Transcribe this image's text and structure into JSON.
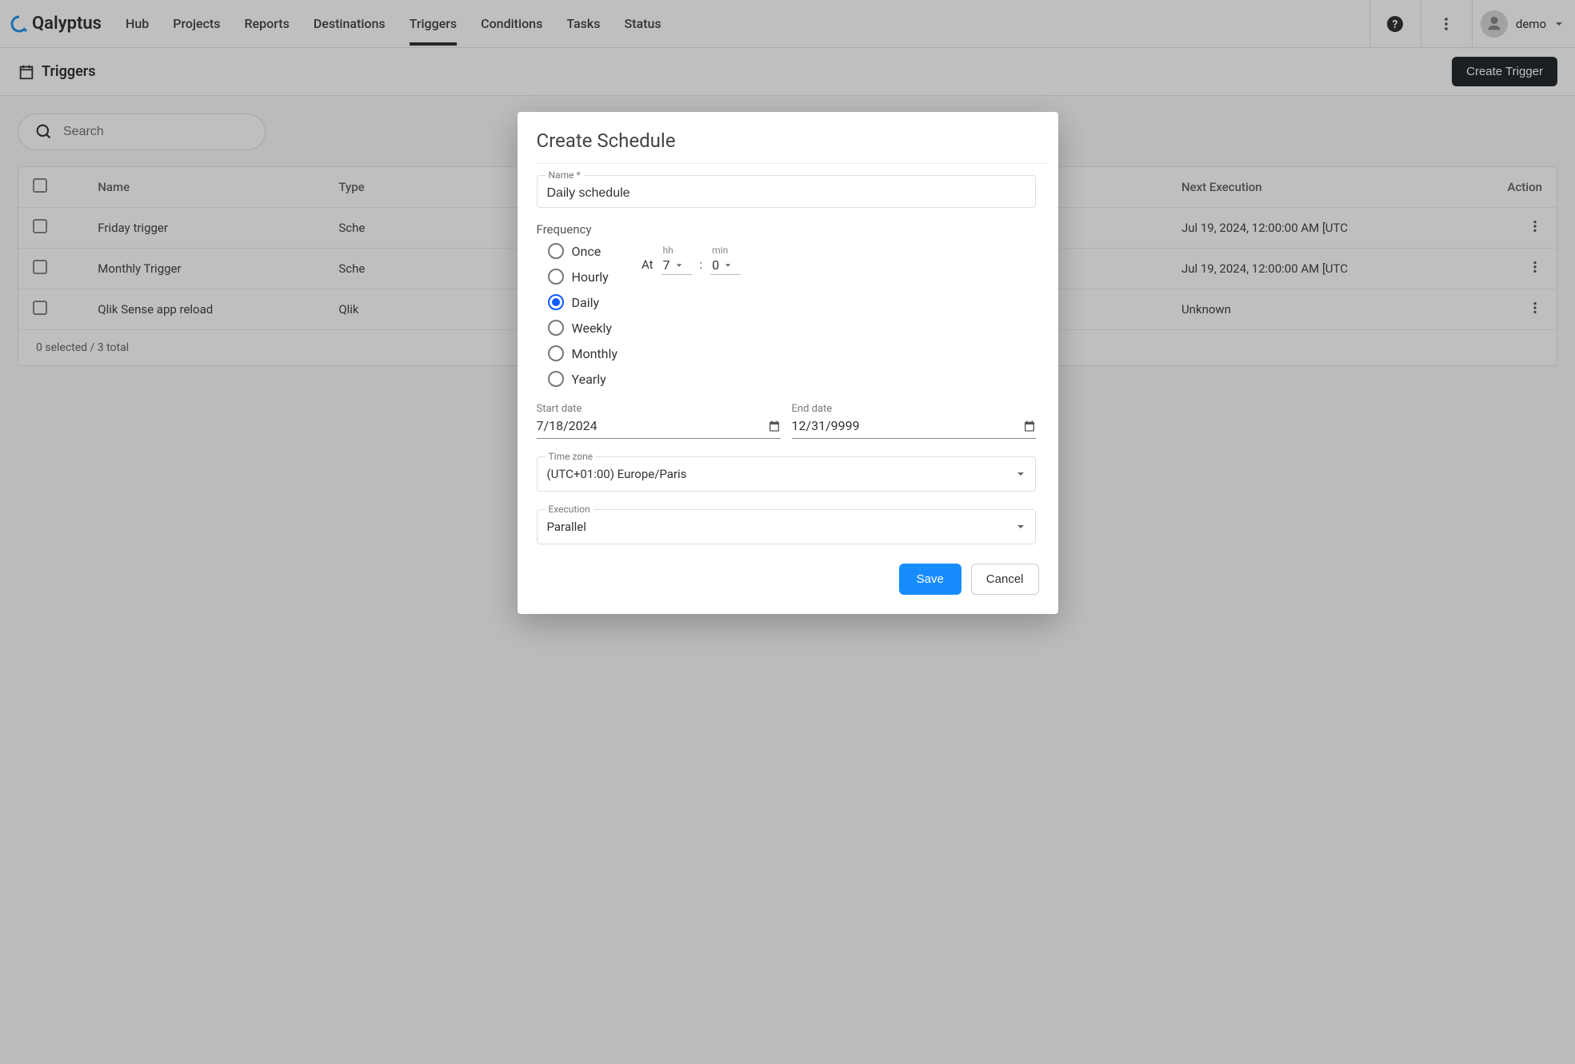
{
  "brand": "Qalyptus",
  "nav": {
    "items": [
      "Hub",
      "Projects",
      "Reports",
      "Destinations",
      "Triggers",
      "Conditions",
      "Tasks",
      "Status"
    ],
    "active_index": 4
  },
  "user": {
    "name": "demo"
  },
  "page": {
    "title": "Triggers",
    "create_button": "Create Trigger",
    "search_placeholder": "Search",
    "columns": [
      "Name",
      "Type",
      "Next Execution",
      "Action"
    ],
    "rows": [
      {
        "name": "Friday trigger",
        "type": "Sche",
        "next": "Jul 19, 2024, 12:00:00 AM [UTC"
      },
      {
        "name": "Monthly Trigger",
        "type": "Sche",
        "next": "Jul 19, 2024, 12:00:00 AM [UTC"
      },
      {
        "name": "Qlik Sense app reload",
        "type": "Qlik",
        "next": "Unknown"
      }
    ],
    "footer": "0 selected / 3 total"
  },
  "dialog": {
    "title": "Create Schedule",
    "name_label": "Name *",
    "name_value": "Daily schedule",
    "frequency_label": "Frequency",
    "frequency_options": [
      "Once",
      "Hourly",
      "Daily",
      "Weekly",
      "Monthly",
      "Yearly"
    ],
    "frequency_selected_index": 2,
    "at_label": "At",
    "hh_label": "hh",
    "hh_value": "7",
    "min_label": "min",
    "min_value": "0",
    "colon": ":",
    "start_date_label": "Start date",
    "start_date_value": "7/18/2024",
    "end_date_label": "End date",
    "end_date_value": "12/31/9999",
    "timezone_label": "Time zone",
    "timezone_value": "(UTC+01:00) Europe/Paris",
    "execution_label": "Execution",
    "execution_value": "Parallel",
    "save_label": "Save",
    "cancel_label": "Cancel"
  }
}
